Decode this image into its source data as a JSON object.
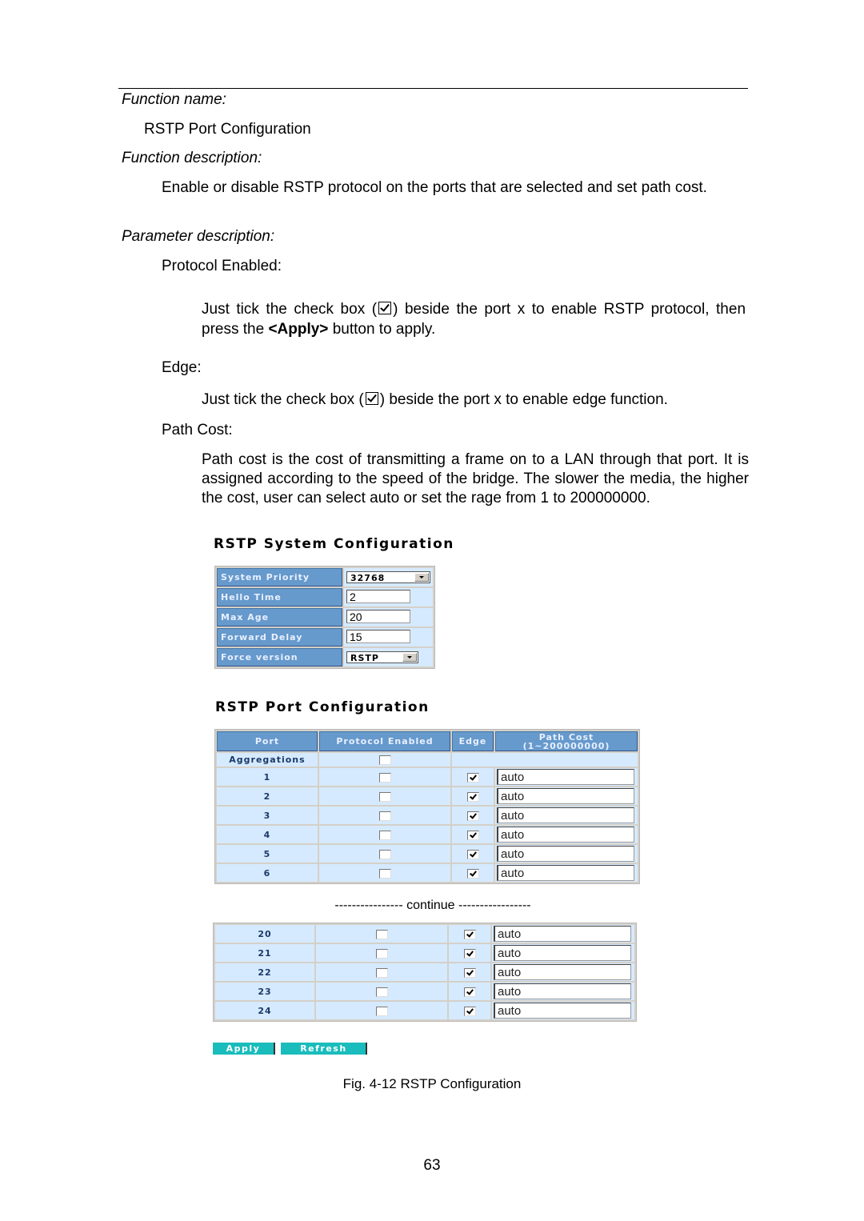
{
  "doc": {
    "function_name_label": "Function name:",
    "function_name": "RSTP Port Configuration",
    "function_description_label": "Function description:",
    "function_description": "Enable or disable RSTP protocol on the ports that are selected and set path cost.",
    "parameter_description_label": "Parameter description:",
    "params": {
      "protocol_enabled": {
        "label": "Protocol Enabled:",
        "text_before": "Just tick the check box (",
        "text_after": ") beside the port x to enable RSTP protocol, then press the ",
        "apply_bold": "<Apply>",
        "text_end": " button to apply."
      },
      "edge": {
        "label": "Edge:",
        "text_before": "Just tick the check box (",
        "text_after": ") beside the port x to enable edge function."
      },
      "path_cost": {
        "label": "Path Cost:",
        "text": "Path cost is the cost of transmitting a frame on to a LAN through that port. It is assigned according to the speed of the bridge. The slower the media, the higher the cost, user can select auto or set the rage from 1 to 200000000."
      }
    },
    "figure_caption": "Fig. 4-12 RSTP Configuration",
    "page_number": "63",
    "continue_text": "---------------- continue -----------------"
  },
  "system_config": {
    "title": "RSTP System Configuration",
    "rows": [
      {
        "label": "System Priority",
        "type": "select",
        "value": "32768"
      },
      {
        "label": "Hello Time",
        "type": "input",
        "value": "2"
      },
      {
        "label": "Max Age",
        "type": "input",
        "value": "20"
      },
      {
        "label": "Forward Delay",
        "type": "input",
        "value": "15"
      },
      {
        "label": "Force version",
        "type": "select",
        "value": "RSTP"
      }
    ]
  },
  "port_config": {
    "title": "RSTP Port Configuration",
    "headers": {
      "port": "Port",
      "protocol_enabled": "Protocol Enabled",
      "edge": "Edge",
      "path_cost": "Path Cost",
      "path_cost_range": "(1~200000000)"
    },
    "aggregations_label": "Aggregations",
    "aggregations_protocol_enabled": false,
    "rows_top": [
      {
        "port": "1",
        "protocol_enabled": false,
        "edge": true,
        "path_cost": "auto"
      },
      {
        "port": "2",
        "protocol_enabled": false,
        "edge": true,
        "path_cost": "auto"
      },
      {
        "port": "3",
        "protocol_enabled": false,
        "edge": true,
        "path_cost": "auto"
      },
      {
        "port": "4",
        "protocol_enabled": false,
        "edge": true,
        "path_cost": "auto"
      },
      {
        "port": "5",
        "protocol_enabled": false,
        "edge": true,
        "path_cost": "auto"
      },
      {
        "port": "6",
        "protocol_enabled": false,
        "edge": true,
        "path_cost": "auto"
      }
    ],
    "rows_bottom": [
      {
        "port": "20",
        "protocol_enabled": false,
        "edge": true,
        "path_cost": "auto"
      },
      {
        "port": "21",
        "protocol_enabled": false,
        "edge": true,
        "path_cost": "auto"
      },
      {
        "port": "22",
        "protocol_enabled": false,
        "edge": true,
        "path_cost": "auto"
      },
      {
        "port": "23",
        "protocol_enabled": false,
        "edge": true,
        "path_cost": "auto"
      },
      {
        "port": "24",
        "protocol_enabled": false,
        "edge": true,
        "path_cost": "auto"
      }
    ],
    "apply_label": "Apply",
    "refresh_label": "Refresh"
  }
}
